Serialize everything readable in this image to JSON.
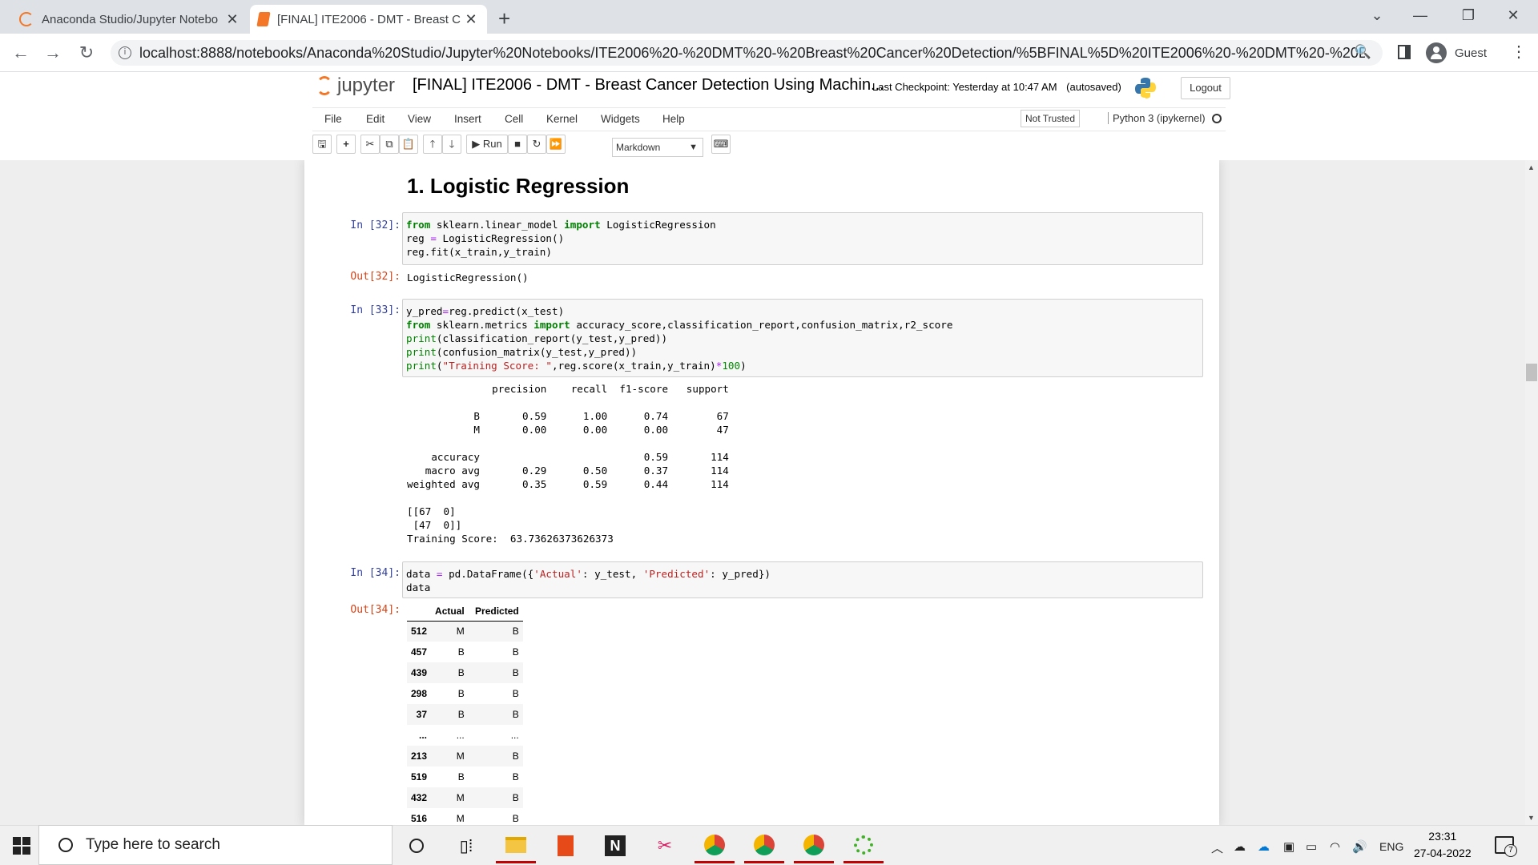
{
  "browser": {
    "tabs": [
      {
        "title": "Anaconda Studio/Jupyter Notebo",
        "icon": "anaconda-icon"
      },
      {
        "title": "[FINAL] ITE2006 - DMT - Breast C",
        "icon": "notebook-icon"
      }
    ],
    "url": "localhost:8888/notebooks/Anaconda%20Studio/Jupyter%20Notebooks/ITE2006%20-%20DMT%20-%20Breast%20Cancer%20Detection/%5BFINAL%5D%20ITE2006%20-%20DMT%20-%20Breast...",
    "profile": "Guest"
  },
  "jupyter": {
    "logo_text": "jupyter",
    "notebook_title": "[FINAL] ITE2006 - DMT - Breast Cancer Detection Using Machin...",
    "checkpoint": "Last Checkpoint: Yesterday at 10:47 AM",
    "autosave": "(autosaved)",
    "logout_label": "Logout",
    "menus": [
      "File",
      "Edit",
      "View",
      "Insert",
      "Cell",
      "Kernel",
      "Widgets",
      "Help"
    ],
    "trust_label": "Not Trusted",
    "kernel_name": "Python 3 (ipykernel)",
    "run_label": "Run",
    "cell_type": "Markdown"
  },
  "notebook": {
    "heading": "1. Logistic Regression",
    "cell32": {
      "in_prompt": "In [32]:",
      "out_prompt": "Out[32]:",
      "output": "LogisticRegression()"
    },
    "cell33": {
      "in_prompt": "In [33]:",
      "report": "              precision    recall  f1-score   support\n\n           B       0.59      1.00      0.74        67\n           M       0.00      0.00      0.00        47\n\n    accuracy                           0.59       114\n   macro avg       0.29      0.50      0.37       114\nweighted avg       0.35      0.59      0.44       114\n\n[[67  0]\n [47  0]]\nTraining Score:  63.73626373626373"
    },
    "cell34": {
      "in_prompt": "In [34]:",
      "out_prompt": "Out[34]:",
      "columns": [
        "",
        "Actual",
        "Predicted"
      ],
      "rows": [
        [
          "512",
          "M",
          "B"
        ],
        [
          "457",
          "B",
          "B"
        ],
        [
          "439",
          "B",
          "B"
        ],
        [
          "298",
          "B",
          "B"
        ],
        [
          "37",
          "B",
          "B"
        ],
        [
          "...",
          "...",
          "..."
        ],
        [
          "213",
          "M",
          "B"
        ],
        [
          "519",
          "B",
          "B"
        ],
        [
          "432",
          "M",
          "B"
        ],
        [
          "516",
          "M",
          "B"
        ]
      ]
    }
  },
  "taskbar": {
    "search_placeholder": "Type here to search",
    "language": "ENG",
    "time": "23:31",
    "date": "27-04-2022",
    "notification_count": "7"
  }
}
